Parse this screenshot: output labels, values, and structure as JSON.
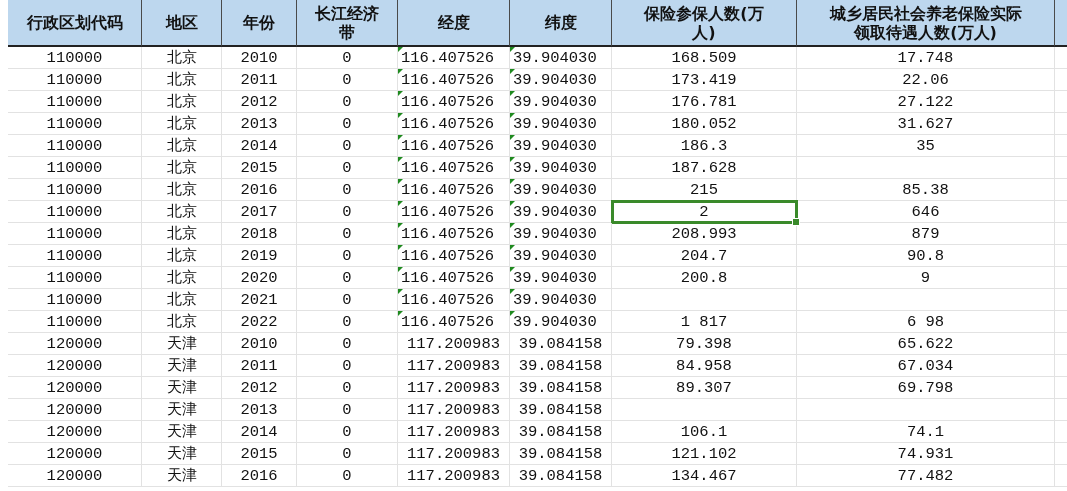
{
  "table": {
    "columns": [
      "行政区划代码",
      "地区",
      "年份",
      "长江经济带",
      "经度",
      "纬度",
      "保险参保人数(万人)",
      "城乡居民社会养老保险实际领取待遇人数(万人)"
    ],
    "rows": [
      {
        "cells": [
          {
            "text": "110000",
            "selected": false
          },
          {
            "text": "北京",
            "selected": false
          },
          {
            "text": "2010",
            "selected": false
          },
          {
            "text": "0",
            "selected": false
          },
          {
            "text": "116.407526",
            "selected": false
          },
          {
            "text": "39.904030",
            "selected": false
          },
          {
            "text": "168.509",
            "selected": false
          },
          {
            "text": "17.748",
            "selected": false
          }
        ],
        "number_as_text": true
      },
      {
        "cells": [
          {
            "text": "110000",
            "selected": false
          },
          {
            "text": "北京",
            "selected": false
          },
          {
            "text": "2011",
            "selected": false
          },
          {
            "text": "0",
            "selected": false
          },
          {
            "text": "116.407526",
            "selected": false
          },
          {
            "text": "39.904030",
            "selected": false
          },
          {
            "text": "173.419",
            "selected": false
          },
          {
            "text": "22.06",
            "selected": false
          }
        ],
        "number_as_text": true
      },
      {
        "cells": [
          {
            "text": "110000",
            "selected": false
          },
          {
            "text": "北京",
            "selected": false
          },
          {
            "text": "2012",
            "selected": false
          },
          {
            "text": "0",
            "selected": false
          },
          {
            "text": "116.407526",
            "selected": false
          },
          {
            "text": "39.904030",
            "selected": false
          },
          {
            "text": "176.781",
            "selected": false
          },
          {
            "text": "27.122",
            "selected": false
          }
        ],
        "number_as_text": true
      },
      {
        "cells": [
          {
            "text": "110000",
            "selected": false
          },
          {
            "text": "北京",
            "selected": false
          },
          {
            "text": "2013",
            "selected": false
          },
          {
            "text": "0",
            "selected": false
          },
          {
            "text": "116.407526",
            "selected": false
          },
          {
            "text": "39.904030",
            "selected": false
          },
          {
            "text": "180.052",
            "selected": false
          },
          {
            "text": "31.627",
            "selected": false
          }
        ],
        "number_as_text": true
      },
      {
        "cells": [
          {
            "text": "110000",
            "selected": false
          },
          {
            "text": "北京",
            "selected": false
          },
          {
            "text": "2014",
            "selected": false
          },
          {
            "text": "0",
            "selected": false
          },
          {
            "text": "116.407526",
            "selected": false
          },
          {
            "text": "39.904030",
            "selected": false
          },
          {
            "text": "186.3",
            "selected": false
          },
          {
            "text": "35",
            "selected": false
          }
        ],
        "number_as_text": true
      },
      {
        "cells": [
          {
            "text": "110000",
            "selected": false
          },
          {
            "text": "北京",
            "selected": false
          },
          {
            "text": "2015",
            "selected": false
          },
          {
            "text": "0",
            "selected": false
          },
          {
            "text": "116.407526",
            "selected": false
          },
          {
            "text": "39.904030",
            "selected": false
          },
          {
            "text": "187.628",
            "selected": false
          },
          {
            "selected": false
          }
        ],
        "number_as_text": true
      },
      {
        "cells": [
          {
            "text": "110000",
            "selected": false
          },
          {
            "text": "北京",
            "selected": false
          },
          {
            "text": "2016",
            "selected": false
          },
          {
            "text": "0",
            "selected": false
          },
          {
            "text": "116.407526",
            "selected": false
          },
          {
            "text": "39.904030",
            "selected": false
          },
          {
            "text": "215",
            "selected": false
          },
          {
            "text": "85.38",
            "selected": false
          }
        ],
        "number_as_text": true
      },
      {
        "cells": [
          {
            "text": "110000",
            "selected": false
          },
          {
            "text": "北京",
            "selected": false
          },
          {
            "text": "2017",
            "selected": false
          },
          {
            "text": "0",
            "selected": false
          },
          {
            "text": "116.407526",
            "selected": false
          },
          {
            "text": "39.904030",
            "selected": false
          },
          {
            "text": "2",
            "selected": true
          },
          {
            "text": "646",
            "selected": false
          }
        ],
        "number_as_text": true
      },
      {
        "cells": [
          {
            "text": "110000",
            "selected": false
          },
          {
            "text": "北京",
            "selected": false
          },
          {
            "text": "2018",
            "selected": false
          },
          {
            "text": "0",
            "selected": false
          },
          {
            "text": "116.407526",
            "selected": false
          },
          {
            "text": "39.904030",
            "selected": false
          },
          {
            "text": "208.993",
            "selected": false
          },
          {
            "text": "879",
            "selected": false
          }
        ],
        "number_as_text": true
      },
      {
        "cells": [
          {
            "text": "110000",
            "selected": false
          },
          {
            "text": "北京",
            "selected": false
          },
          {
            "text": "2019",
            "selected": false
          },
          {
            "text": "0",
            "selected": false
          },
          {
            "text": "116.407526",
            "selected": false
          },
          {
            "text": "39.904030",
            "selected": false
          },
          {
            "text": "204.7",
            "selected": false
          },
          {
            "text": "90.8",
            "selected": false
          }
        ],
        "number_as_text": true
      },
      {
        "cells": [
          {
            "text": "110000",
            "selected": false
          },
          {
            "text": "北京",
            "selected": false
          },
          {
            "text": "2020",
            "selected": false
          },
          {
            "text": "0",
            "selected": false
          },
          {
            "text": "116.407526",
            "selected": false
          },
          {
            "text": "39.904030",
            "selected": false
          },
          {
            "text": "200.8",
            "selected": false
          },
          {
            "text": "9",
            "selected": false
          }
        ],
        "number_as_text": true
      },
      {
        "cells": [
          {
            "text": "110000",
            "selected": false
          },
          {
            "text": "北京",
            "selected": false
          },
          {
            "text": "2021",
            "selected": false
          },
          {
            "text": "0",
            "selected": false
          },
          {
            "text": "116.407526",
            "selected": false
          },
          {
            "text": "39.904030",
            "selected": false
          },
          {
            "selected": false
          },
          {
            "selected": false
          }
        ],
        "number_as_text": true
      },
      {
        "cells": [
          {
            "text": "110000",
            "selected": false
          },
          {
            "text": "北京",
            "selected": false
          },
          {
            "text": "2022",
            "selected": false
          },
          {
            "text": "0",
            "selected": false
          },
          {
            "text": "116.407526",
            "selected": false
          },
          {
            "text": "39.904030",
            "selected": false
          },
          {
            "text": "1 817",
            "selected": false
          },
          {
            "text": "6 98",
            "selected": false
          }
        ],
        "number_as_text": true
      },
      {
        "cells": [
          {
            "text": "120000",
            "selected": false
          },
          {
            "text": "天津",
            "selected": false
          },
          {
            "text": "2010",
            "selected": false
          },
          {
            "text": "0",
            "selected": false
          },
          {
            "text": "117.200983",
            "selected": false
          },
          {
            "text": "39.084158",
            "selected": false
          },
          {
            "text": "79.398",
            "selected": false
          },
          {
            "text": "65.622",
            "selected": false
          }
        ],
        "number_as_text": false
      },
      {
        "cells": [
          {
            "text": "120000",
            "selected": false
          },
          {
            "text": "天津",
            "selected": false
          },
          {
            "text": "2011",
            "selected": false
          },
          {
            "text": "0",
            "selected": false
          },
          {
            "text": "117.200983",
            "selected": false
          },
          {
            "text": "39.084158",
            "selected": false
          },
          {
            "text": "84.958",
            "selected": false
          },
          {
            "text": "67.034",
            "selected": false
          }
        ],
        "number_as_text": false
      },
      {
        "cells": [
          {
            "text": "120000",
            "selected": false
          },
          {
            "text": "天津",
            "selected": false
          },
          {
            "text": "2012",
            "selected": false
          },
          {
            "text": "0",
            "selected": false
          },
          {
            "text": "117.200983",
            "selected": false
          },
          {
            "text": "39.084158",
            "selected": false
          },
          {
            "text": "89.307",
            "selected": false
          },
          {
            "text": "69.798",
            "selected": false
          }
        ],
        "number_as_text": false
      },
      {
        "cells": [
          {
            "text": "120000",
            "selected": false
          },
          {
            "text": "天津",
            "selected": false
          },
          {
            "text": "2013",
            "selected": false
          },
          {
            "text": "0",
            "selected": false
          },
          {
            "text": "117.200983",
            "selected": false
          },
          {
            "text": "39.084158",
            "selected": false
          },
          {
            "selected": false
          },
          {
            "selected": false
          }
        ],
        "number_as_text": false
      },
      {
        "cells": [
          {
            "text": "120000",
            "selected": false
          },
          {
            "text": "天津",
            "selected": false
          },
          {
            "text": "2014",
            "selected": false
          },
          {
            "text": "0",
            "selected": false
          },
          {
            "text": "117.200983",
            "selected": false
          },
          {
            "text": "39.084158",
            "selected": false
          },
          {
            "text": "106.1",
            "selected": false
          },
          {
            "text": "74.1",
            "selected": false
          }
        ],
        "number_as_text": false
      },
      {
        "cells": [
          {
            "text": "120000",
            "selected": false
          },
          {
            "text": "天津",
            "selected": false
          },
          {
            "text": "2015",
            "selected": false
          },
          {
            "text": "0",
            "selected": false
          },
          {
            "text": "117.200983",
            "selected": false
          },
          {
            "text": "39.084158",
            "selected": false
          },
          {
            "text": "121.102",
            "selected": false
          },
          {
            "text": "74.931",
            "selected": false
          }
        ],
        "number_as_text": false
      },
      {
        "cells": [
          {
            "text": "120000",
            "selected": false
          },
          {
            "text": "天津",
            "selected": false
          },
          {
            "text": "2016",
            "selected": false
          },
          {
            "text": "0",
            "selected": false
          },
          {
            "text": "117.200983",
            "selected": false
          },
          {
            "text": "39.084158",
            "selected": false
          },
          {
            "text": "134.467",
            "selected": false
          },
          {
            "text": "77.482",
            "selected": false
          }
        ],
        "number_as_text": false
      }
    ]
  }
}
